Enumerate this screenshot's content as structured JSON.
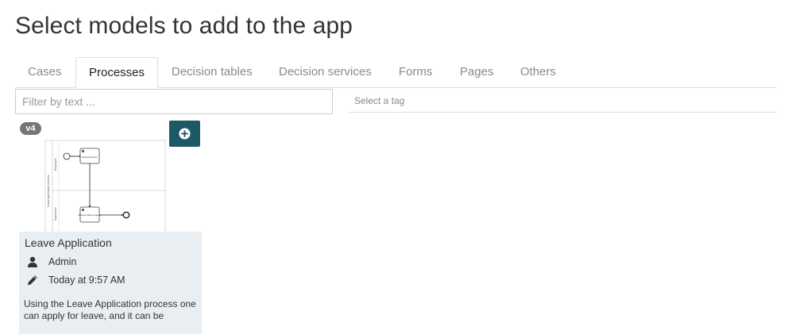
{
  "page": {
    "title": "Select models to add to the app"
  },
  "tabs": [
    {
      "label": "Cases",
      "active": false
    },
    {
      "label": "Processes",
      "active": true
    },
    {
      "label": "Decision tables",
      "active": false
    },
    {
      "label": "Decision services",
      "active": false
    },
    {
      "label": "Forms",
      "active": false
    },
    {
      "label": "Pages",
      "active": false
    },
    {
      "label": "Others",
      "active": false
    }
  ],
  "filter": {
    "placeholder": "Filter by text ...",
    "value": ""
  },
  "tag_select": {
    "placeholder": "Select a tag"
  },
  "models": [
    {
      "version": "v4",
      "name": "Leave Application",
      "owner": "Admin",
      "last_updated": "Today at 9:57 AM",
      "description": "Using the Leave Application process one can apply for leave, and it can be",
      "icons": {
        "add": "plus-circle-icon",
        "owner": "user-icon",
        "updated": "pencil-icon"
      },
      "diagram": {
        "pool_label": "Leave application process",
        "lanes": [
          "Employee",
          "Supervisor"
        ],
        "tasks": [
          "Request leave",
          "Review leave request"
        ]
      }
    }
  ],
  "colors": {
    "accent": "#1b5966",
    "badge": "#757575",
    "card_background": "#e8eef2",
    "active_tab_text": "#222222",
    "inactive_tab_text": "#8a8a8a"
  }
}
